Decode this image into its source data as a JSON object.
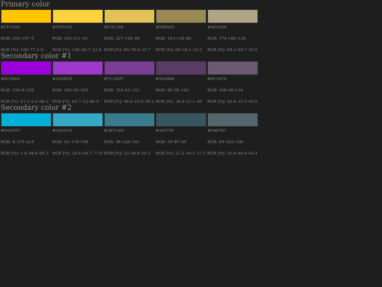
{
  "sections": [
    {
      "title": "Primary color",
      "swatches": [
        {
          "color": "#FFC500",
          "hex": "#FFC500",
          "rgb": "RGB: 255–197–0",
          "pct": "RGB [%]: 100–77.3–0"
        },
        {
          "color": "#FFD33D",
          "hex": "#FFD33D",
          "rgb": "RGB: 255–211–61",
          "pct": "RGB [%]: 100–82.7–23.9"
        },
        {
          "color": "#E3C356",
          "hex": "#E3C356",
          "rgb": "RGB: 227–195–86",
          "pct": "RGB [%]: 89–76.5–33.7"
        },
        {
          "color": "#998A55",
          "hex": "#998A55",
          "rgb": "RGB: 153–138–85",
          "pct": "RGB [%]: 60–54.1–33.3"
        },
        {
          "color": "#AEA586",
          "hex": "#AEA586",
          "rgb": "RGB: 174–165–134",
          "pct": "RGB [%]: 68.2–64.7–52.5"
        }
      ]
    },
    {
      "title": "Secondary color #1",
      "swatches": [
        {
          "color": "#9C00DC",
          "hex": "#9C00DC",
          "rgb": "RGB: 156–0–220",
          "pct": "RGB [%]: 61.2–2.4–86.3"
        },
        {
          "color": "#A038CD",
          "hex": "#A038CD",
          "rgb": "RGB: 160–56–205",
          "pct": "RGB [%]: 62.7–22–80.4"
        },
        {
          "color": "#7C3D97",
          "hex": "#7C3D97",
          "rgb": "RGB: 124–61–151",
          "pct": "RGB [%]: 48.6–23.9–59.2"
        },
        {
          "color": "#593B66",
          "hex": "#593B66",
          "rgb": "RGB: 89–59–102",
          "pct": "RGB [%]: 34.9–23.1–40"
        },
        {
          "color": "#6C5A74",
          "hex": "#6C5A74",
          "rgb": "RGB: 108–90–116",
          "pct": "RGB [%]: 42.4–35.3–45.5"
        }
      ]
    },
    {
      "title": "Secondary color #2",
      "swatches": [
        {
          "color": "#04AFD7",
          "hex": "#04AFD7",
          "rgb": "RGB: 4–175–215",
          "pct": "RGB [%]: 1.6–68.6–84.3"
        },
        {
          "color": "#34AAC6",
          "hex": "#34AAC6",
          "rgb": "RGB: 52–170–198",
          "pct": "RGB [%]: 20.4–66.7–77.6"
        },
        {
          "color": "#387C8D",
          "hex": "#387C8D",
          "rgb": "RGB: 56–124–141",
          "pct": "RGB [%]: 22–48.6–55.3"
        },
        {
          "color": "#36575F",
          "hex": "#36575F",
          "rgb": "RGB: 54–87–95",
          "pct": "RGB [%]: 21.2–34.1–37.3"
        },
        {
          "color": "#54676C",
          "hex": "#54676C",
          "rgb": "RGB: 84–103–108",
          "pct": "RGB [%]: 32.9–40.4–42.4"
        }
      ]
    }
  ]
}
